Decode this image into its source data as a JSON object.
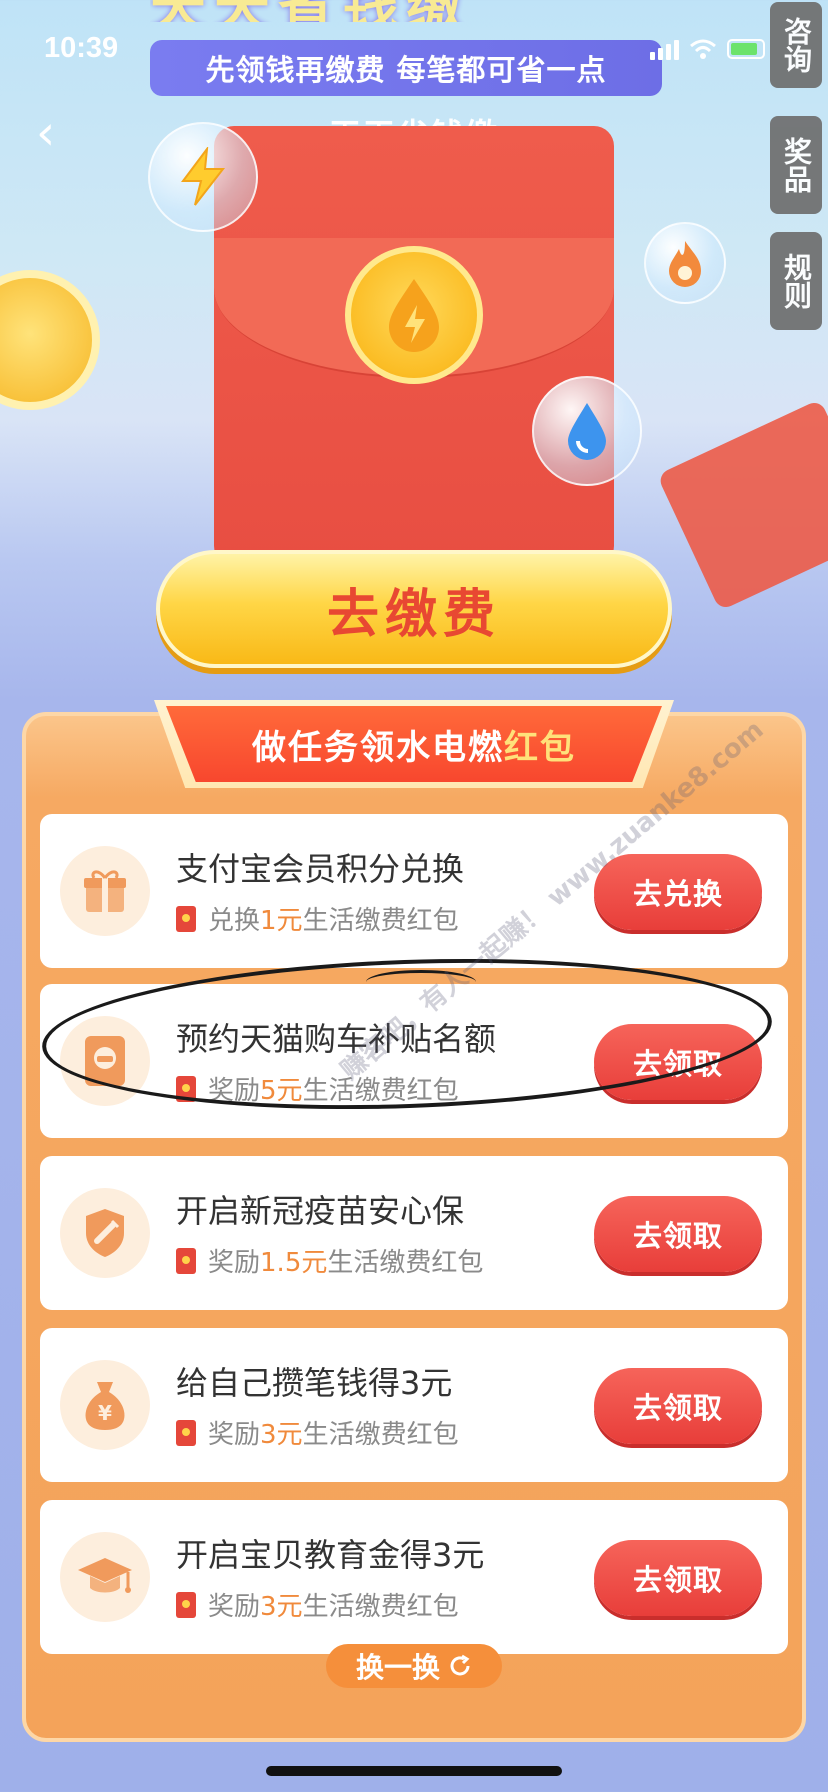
{
  "status_bar": {
    "time": "10:39"
  },
  "banner": {
    "headline": "天天省钱缴",
    "subtitle": "先领钱再缴费 每笔都可省一点"
  },
  "header": {
    "title": "天天省钱缴",
    "back_glyph": "‹"
  },
  "side_tabs": [
    {
      "label": "咨询"
    },
    {
      "label": "奖品"
    },
    {
      "label": "规则"
    }
  ],
  "pay_button": {
    "label": "去缴费"
  },
  "panel": {
    "title_main": "做任务领水电燃",
    "title_highlight": "红包"
  },
  "tasks": [
    {
      "title": "支付宝会员积分兑换",
      "sub_prefix": "兑换",
      "amount": "1元",
      "sub_suffix": "生活缴费红包",
      "button": "去兑换",
      "icon": "gift-icon"
    },
    {
      "title": "预约天猫购车补贴名额",
      "sub_prefix": "奖励",
      "amount": "5元",
      "sub_suffix": "生活缴费红包",
      "button": "去领取",
      "icon": "car-card-icon"
    },
    {
      "title": "开启新冠疫苗安心保",
      "sub_prefix": "奖励",
      "amount": "1.5元",
      "sub_suffix": "生活缴费红包",
      "button": "去领取",
      "icon": "shield-vaccine-icon"
    },
    {
      "title": "给自己攒笔钱得3元",
      "sub_prefix": "奖励",
      "amount": "3元",
      "sub_suffix": "生活缴费红包",
      "button": "去领取",
      "icon": "money-bag-icon"
    },
    {
      "title": "开启宝贝教育金得3元",
      "sub_prefix": "奖励",
      "amount": "3元",
      "sub_suffix": "生活缴费红包",
      "button": "去领取",
      "icon": "graduation-cap-icon"
    }
  ],
  "refresh_button": {
    "label": "换一换"
  },
  "watermark": "赚客吧，有人一起赚！ www.zuanke8.com",
  "colors": {
    "accent_red": "#e83e3a",
    "panel_orange": "#f4a35a",
    "amount_orange": "#f08a3c"
  }
}
